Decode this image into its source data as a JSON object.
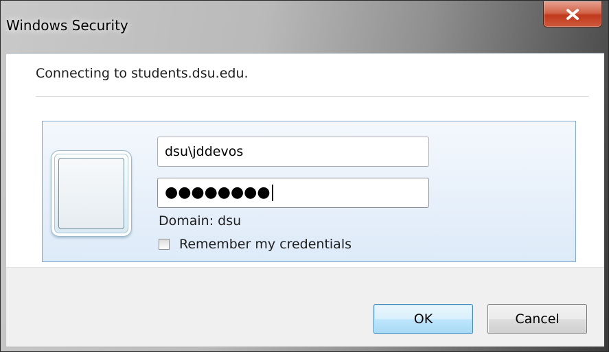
{
  "window": {
    "title": "Windows Security",
    "close_icon": "close-x-icon"
  },
  "dialog": {
    "connecting_text": "Connecting to students.dsu.edu."
  },
  "credentials": {
    "user_tile_icon": "user-tile-icon",
    "username_value": "dsu\\jddevos",
    "password_masked": "●●●●●●●●",
    "domain_text": "Domain: dsu",
    "remember_label": "Remember my credentials",
    "remember_checked": false
  },
  "buttons": {
    "ok_label": "OK",
    "cancel_label": "Cancel"
  },
  "colors": {
    "close_button": "#c73a1f",
    "ok_button_border": "#3c7fb1",
    "panel_border": "#7ea6cf"
  }
}
